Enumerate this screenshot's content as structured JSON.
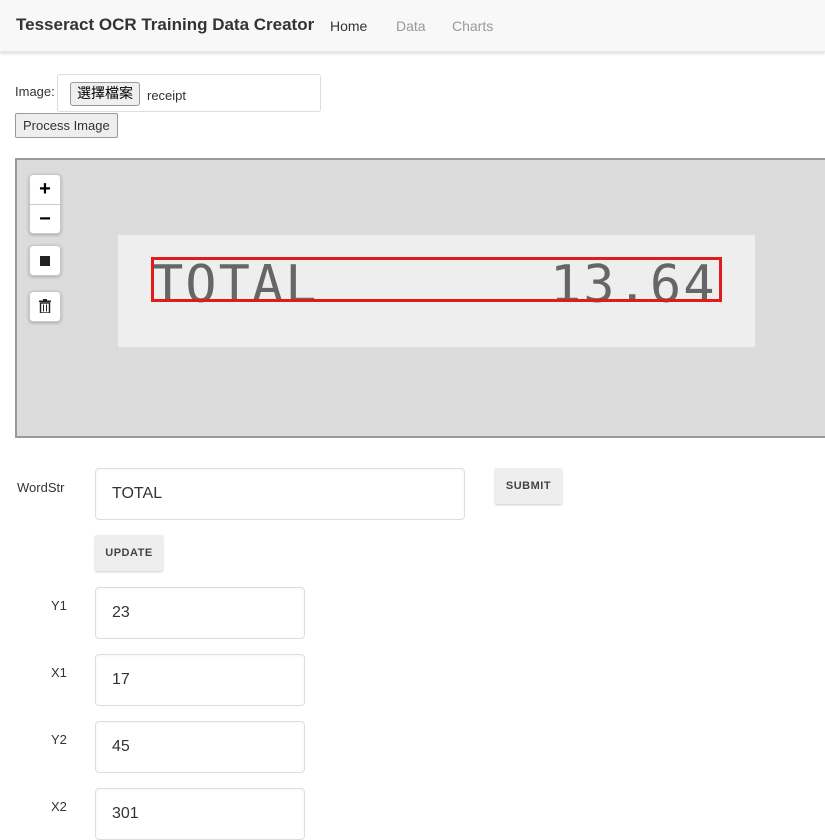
{
  "navbar": {
    "brand": "Tesseract OCR Training Data Creator",
    "links": [
      "Home",
      "Data",
      "Charts"
    ]
  },
  "upload": {
    "image_label": "Image:",
    "choose_file_label": "選擇檔案",
    "file_name": "receipt",
    "process_button": "Process Image"
  },
  "canvas": {
    "controls": {
      "zoom_in": "+",
      "zoom_out": "−"
    },
    "receipt_text_left": "TOTAL",
    "receipt_text_right": "13.64"
  },
  "form": {
    "wordstr_label": "WordStr",
    "wordstr_value": "TOTAL",
    "submit_label": "SUBMIT",
    "update_label": "UPDATE",
    "y1_label": "Y1",
    "y1_value": "23",
    "x1_label": "X1",
    "x1_value": "17",
    "y2_label": "Y2",
    "y2_value": "45",
    "x2_label": "X2",
    "x2_value": "301"
  }
}
